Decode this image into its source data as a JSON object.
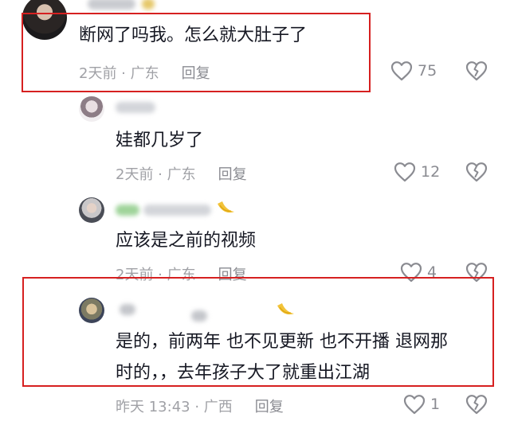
{
  "comments": [
    {
      "text": "断网了吗我。怎么就大肚子了",
      "time": "2天前",
      "location": "广东",
      "reply_label": "回复",
      "likes": "75"
    },
    {
      "text": "娃都几岁了",
      "time": "2天前",
      "location": "广东",
      "reply_label": "回复",
      "likes": "12"
    },
    {
      "text": "应该是之前的视频",
      "time": "2天前",
      "location": "广东",
      "reply_label": "回复",
      "likes": "4"
    },
    {
      "text_line1": "是的，前两年 也不见更新 也不开播 退网那",
      "text_line2": "时的，，去年孩子大了就重出江湖",
      "time": "昨天 13:43",
      "location": "广西",
      "reply_label": "回复",
      "likes": "1"
    }
  ],
  "icons": {
    "like": "heart-outline-icon",
    "dislike": "broken-heart-icon"
  },
  "colors": {
    "highlight_box": "#d62020",
    "text": "#161823",
    "meta": "#a0a1a6"
  }
}
